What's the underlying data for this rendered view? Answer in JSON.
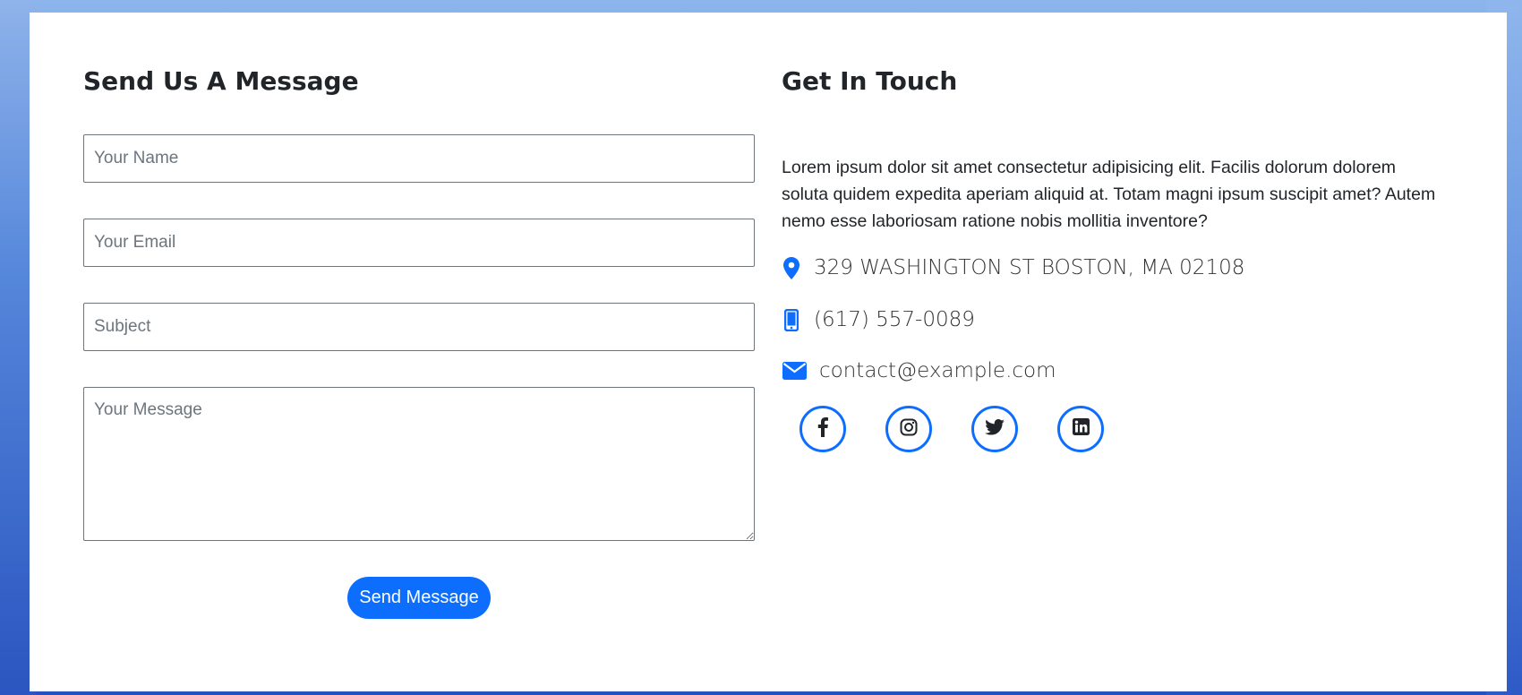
{
  "form": {
    "title": "Send Us A Message",
    "name_placeholder": "Your Name",
    "email_placeholder": "Your Email",
    "subject_placeholder": "Subject",
    "message_placeholder": "Your Message",
    "submit_label": "Send Message"
  },
  "contact": {
    "title": "Get In Touch",
    "intro": "Lorem ipsum dolor sit amet consectetur adipisicing elit. Facilis dolorum dolorem soluta quidem expedita aperiam aliquid at. Totam magni ipsum suscipit amet? Autem nemo esse laboriosam ratione nobis mollitia inventore?",
    "address": "329 WASHINGTON ST BOSTON, MA 02108",
    "phone": "(617) 557-0089",
    "email": "contact@example.com",
    "address_icon": "map-marker-icon",
    "phone_icon": "mobile-phone-icon",
    "email_icon": "envelope-icon"
  },
  "social": [
    {
      "icon": "facebook-icon"
    },
    {
      "icon": "instagram-icon"
    },
    {
      "icon": "twitter-icon"
    },
    {
      "icon": "linkedin-icon"
    }
  ],
  "colors": {
    "accent": "#0d6efd",
    "text": "#212529"
  }
}
